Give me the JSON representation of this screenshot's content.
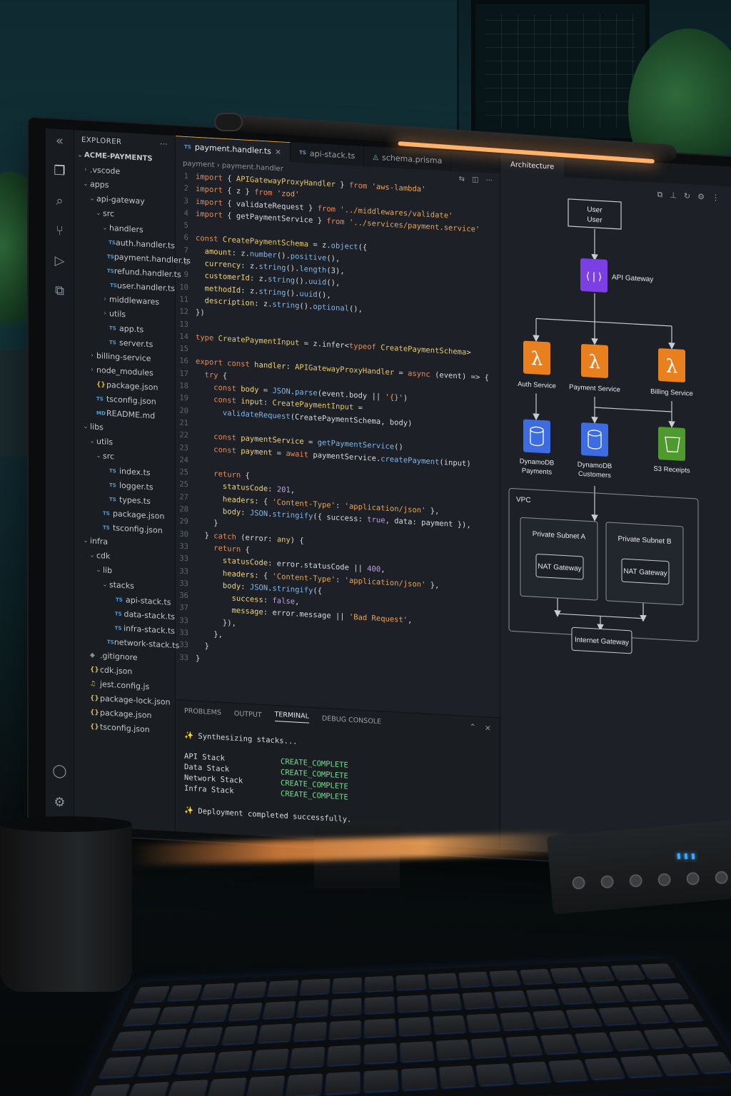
{
  "explorer": {
    "title": "EXPLORER",
    "more": "···",
    "root": "ACME-PAYMENTS",
    "tree": [
      {
        "depth": 0,
        "chev": "›",
        "icon": "",
        "label": ".vscode"
      },
      {
        "depth": 0,
        "chev": "⌄",
        "icon": "",
        "label": "apps"
      },
      {
        "depth": 1,
        "chev": "⌄",
        "icon": "",
        "label": "api-gateway"
      },
      {
        "depth": 2,
        "chev": "⌄",
        "icon": "",
        "label": "src"
      },
      {
        "depth": 3,
        "chev": "⌄",
        "icon": "",
        "label": "handlers"
      },
      {
        "depth": 4,
        "chev": "",
        "icon": "TS",
        "label": "auth.handler.ts"
      },
      {
        "depth": 4,
        "chev": "",
        "icon": "TS",
        "label": "payment.handler.ts"
      },
      {
        "depth": 4,
        "chev": "",
        "icon": "TS",
        "label": "refund.handler.ts"
      },
      {
        "depth": 4,
        "chev": "",
        "icon": "TS",
        "label": "user.handler.ts"
      },
      {
        "depth": 3,
        "chev": "›",
        "icon": "",
        "label": "middlewares"
      },
      {
        "depth": 3,
        "chev": "›",
        "icon": "",
        "label": "utils"
      },
      {
        "depth": 3,
        "chev": "",
        "icon": "TS",
        "label": "app.ts"
      },
      {
        "depth": 3,
        "chev": "",
        "icon": "TS",
        "label": "server.ts"
      },
      {
        "depth": 1,
        "chev": "›",
        "icon": "",
        "label": "billing-service"
      },
      {
        "depth": 1,
        "chev": "›",
        "icon": "",
        "label": "node_modules"
      },
      {
        "depth": 1,
        "chev": "",
        "icon": "{}",
        "label": "package.json"
      },
      {
        "depth": 1,
        "chev": "",
        "icon": "TS",
        "label": "tsconfig.json"
      },
      {
        "depth": 1,
        "chev": "",
        "icon": "MD",
        "label": "README.md"
      },
      {
        "depth": 0,
        "chev": "⌄",
        "icon": "",
        "label": "libs"
      },
      {
        "depth": 1,
        "chev": "⌄",
        "icon": "",
        "label": "utils"
      },
      {
        "depth": 2,
        "chev": "⌄",
        "icon": "",
        "label": "src"
      },
      {
        "depth": 3,
        "chev": "",
        "icon": "TS",
        "label": "index.ts"
      },
      {
        "depth": 3,
        "chev": "",
        "icon": "TS",
        "label": "logger.ts"
      },
      {
        "depth": 3,
        "chev": "",
        "icon": "TS",
        "label": "types.ts"
      },
      {
        "depth": 2,
        "chev": "",
        "icon": "TS",
        "label": "package.json"
      },
      {
        "depth": 2,
        "chev": "",
        "icon": "TS",
        "label": "tsconfig.json"
      },
      {
        "depth": 0,
        "chev": "⌄",
        "icon": "",
        "label": "infra"
      },
      {
        "depth": 1,
        "chev": "⌄",
        "icon": "",
        "label": "cdk"
      },
      {
        "depth": 2,
        "chev": "⌄",
        "icon": "",
        "label": "lib"
      },
      {
        "depth": 3,
        "chev": "⌄",
        "icon": "",
        "label": "stacks"
      },
      {
        "depth": 4,
        "chev": "",
        "icon": "TS",
        "label": "api-stack.ts"
      },
      {
        "depth": 4,
        "chev": "",
        "icon": "TS",
        "label": "data-stack.ts"
      },
      {
        "depth": 4,
        "chev": "",
        "icon": "TS",
        "label": "infra-stack.ts"
      },
      {
        "depth": 4,
        "chev": "",
        "icon": "TS",
        "label": "network-stack.ts"
      },
      {
        "depth": 0,
        "chev": "",
        "icon": "◆",
        "label": ".gitignore"
      },
      {
        "depth": 0,
        "chev": "",
        "icon": "{}",
        "label": "cdk.json"
      },
      {
        "depth": 0,
        "chev": "",
        "icon": "♫",
        "label": "jest.config.js"
      },
      {
        "depth": 0,
        "chev": "",
        "icon": "{}",
        "label": "package-lock.json"
      },
      {
        "depth": 0,
        "chev": "",
        "icon": "{}",
        "label": "package.json"
      },
      {
        "depth": 0,
        "chev": "",
        "icon": "{}",
        "label": "tsconfig.json"
      }
    ]
  },
  "tabs": [
    {
      "icon": "TS",
      "label": "payment.handler.ts",
      "active": true,
      "close": "×"
    },
    {
      "icon": "TS",
      "label": "api-stack.ts",
      "active": false,
      "close": ""
    },
    {
      "icon": "◬",
      "label": "schema.prisma",
      "active": false,
      "close": ""
    }
  ],
  "breadcrumb": "payment › payment.handler",
  "code": [
    {
      "n": "1",
      "parts": [
        [
          "k",
          "import"
        ],
        [
          "p",
          " { "
        ],
        [
          "t",
          "APIGatewayProxyHandler"
        ],
        [
          "p",
          " } "
        ],
        [
          "k",
          "from"
        ],
        [
          "s",
          " 'aws-lambda'"
        ]
      ]
    },
    {
      "n": "2",
      "parts": [
        [
          "k",
          "import"
        ],
        [
          "p",
          " { z } "
        ],
        [
          "k",
          "from"
        ],
        [
          "s",
          " 'zod'"
        ]
      ]
    },
    {
      "n": "3",
      "parts": [
        [
          "k",
          "import"
        ],
        [
          "p",
          " { validateRequest } "
        ],
        [
          "k",
          "from"
        ],
        [
          "s",
          " '../middlewares/validate'"
        ]
      ]
    },
    {
      "n": "4",
      "parts": [
        [
          "k",
          "import"
        ],
        [
          "p",
          " { getPaymentService } "
        ],
        [
          "k",
          "from"
        ],
        [
          "s",
          " '../services/payment.service'"
        ]
      ]
    },
    {
      "n": "5",
      "parts": []
    },
    {
      "n": "6",
      "parts": [
        [
          "k",
          "const"
        ],
        [
          "t",
          " CreatePaymentSchema"
        ],
        [
          "p",
          " = z."
        ],
        [
          "f",
          "object"
        ],
        [
          "p",
          "({"
        ]
      ]
    },
    {
      "n": "7",
      "parts": [
        [
          "v",
          "  amount"
        ],
        [
          "p",
          ": z."
        ],
        [
          "f",
          "number"
        ],
        [
          "p",
          "()."
        ],
        [
          "f",
          "positive"
        ],
        [
          "p",
          "(),"
        ]
      ]
    },
    {
      "n": "8",
      "parts": [
        [
          "v",
          "  currency"
        ],
        [
          "p",
          ": z."
        ],
        [
          "f",
          "string"
        ],
        [
          "p",
          "()."
        ],
        [
          "f",
          "length"
        ],
        [
          "p",
          "(3),"
        ]
      ]
    },
    {
      "n": "9",
      "parts": [
        [
          "v",
          "  customerId"
        ],
        [
          "p",
          ": z."
        ],
        [
          "f",
          "string"
        ],
        [
          "p",
          "()."
        ],
        [
          "f",
          "uuid"
        ],
        [
          "p",
          "(),"
        ]
      ]
    },
    {
      "n": "10",
      "parts": [
        [
          "v",
          "  methodId"
        ],
        [
          "p",
          ": z."
        ],
        [
          "f",
          "string"
        ],
        [
          "p",
          "()."
        ],
        [
          "f",
          "uuid"
        ],
        [
          "p",
          "(),"
        ]
      ]
    },
    {
      "n": "11",
      "parts": [
        [
          "v",
          "  description"
        ],
        [
          "p",
          ": z."
        ],
        [
          "f",
          "string"
        ],
        [
          "p",
          "()."
        ],
        [
          "f",
          "optional"
        ],
        [
          "p",
          "(),"
        ]
      ]
    },
    {
      "n": "12",
      "parts": [
        [
          "p",
          "})"
        ]
      ]
    },
    {
      "n": "13",
      "parts": []
    },
    {
      "n": "14",
      "parts": [
        [
          "k",
          "type"
        ],
        [
          "t",
          " CreatePaymentInput"
        ],
        [
          "p",
          " = z.infer<"
        ],
        [
          "k",
          "typeof"
        ],
        [
          "t",
          " CreatePaymentSchema"
        ],
        [
          "p",
          ">"
        ]
      ]
    },
    {
      "n": "15",
      "parts": []
    },
    {
      "n": "16",
      "parts": [
        [
          "k",
          "export const"
        ],
        [
          "v",
          " handler"
        ],
        [
          "p",
          ": "
        ],
        [
          "t",
          "APIGatewayProxyHandler"
        ],
        [
          "p",
          " = "
        ],
        [
          "k",
          "async"
        ],
        [
          "p",
          " (event) => {"
        ]
      ]
    },
    {
      "n": "17",
      "parts": [
        [
          "k",
          "  try"
        ],
        [
          "p",
          " {"
        ]
      ]
    },
    {
      "n": "18",
      "parts": [
        [
          "k",
          "    const"
        ],
        [
          "v",
          " body"
        ],
        [
          "p",
          " = "
        ],
        [
          "f",
          "JSON"
        ],
        [
          "p",
          "."
        ],
        [
          "f",
          "parse"
        ],
        [
          "p",
          "(event.body || "
        ],
        [
          "s",
          "'{}'"
        ],
        [
          "p",
          ")"
        ]
      ]
    },
    {
      "n": "19",
      "parts": [
        [
          "k",
          "    const"
        ],
        [
          "v",
          " input"
        ],
        [
          "p",
          ": "
        ],
        [
          "t",
          "CreatePaymentInput"
        ],
        [
          "p",
          " ="
        ]
      ]
    },
    {
      "n": "20",
      "parts": [
        [
          "f",
          "      validateRequest"
        ],
        [
          "p",
          "(CreatePaymentSchema, body)"
        ]
      ]
    },
    {
      "n": "21",
      "parts": []
    },
    {
      "n": "22",
      "parts": [
        [
          "k",
          "    const"
        ],
        [
          "v",
          " paymentService"
        ],
        [
          "p",
          " = "
        ],
        [
          "f",
          "getPaymentService"
        ],
        [
          "p",
          "()"
        ]
      ]
    },
    {
      "n": "23",
      "parts": [
        [
          "k",
          "    const"
        ],
        [
          "v",
          " payment"
        ],
        [
          "p",
          " = "
        ],
        [
          "k",
          "await"
        ],
        [
          "p",
          " paymentService."
        ],
        [
          "f",
          "createPayment"
        ],
        [
          "p",
          "(input)"
        ]
      ]
    },
    {
      "n": "24",
      "parts": []
    },
    {
      "n": "25",
      "parts": [
        [
          "k",
          "    return"
        ],
        [
          "p",
          " {"
        ]
      ]
    },
    {
      "n": "25",
      "parts": [
        [
          "v",
          "      statusCode"
        ],
        [
          "p",
          ": "
        ],
        [
          "n",
          "201"
        ],
        [
          "p",
          ","
        ]
      ]
    },
    {
      "n": "27",
      "parts": [
        [
          "v",
          "      headers"
        ],
        [
          "p",
          ": { "
        ],
        [
          "s",
          "'Content-Type'"
        ],
        [
          "p",
          ": "
        ],
        [
          "s",
          "'application/json'"
        ],
        [
          "p",
          " },"
        ]
      ]
    },
    {
      "n": "28",
      "parts": [
        [
          "v",
          "      body"
        ],
        [
          "p",
          ": "
        ],
        [
          "f",
          "JSON"
        ],
        [
          "p",
          "."
        ],
        [
          "f",
          "stringify"
        ],
        [
          "p",
          "({ success: "
        ],
        [
          "n",
          "true"
        ],
        [
          "p",
          ", data: payment }),"
        ]
      ]
    },
    {
      "n": "29",
      "parts": [
        [
          "p",
          "    }"
        ]
      ]
    },
    {
      "n": "30",
      "parts": [
        [
          "p",
          "  } "
        ],
        [
          "k",
          "catch"
        ],
        [
          "p",
          " (error: "
        ],
        [
          "t",
          "any"
        ],
        [
          "p",
          ") {"
        ]
      ]
    },
    {
      "n": "33",
      "parts": [
        [
          "k",
          "    return"
        ],
        [
          "p",
          " {"
        ]
      ]
    },
    {
      "n": "33",
      "parts": [
        [
          "v",
          "      statusCode"
        ],
        [
          "p",
          ": error.statusCode || "
        ],
        [
          "n",
          "400"
        ],
        [
          "p",
          ","
        ]
      ]
    },
    {
      "n": "33",
      "parts": [
        [
          "v",
          "      headers"
        ],
        [
          "p",
          ": { "
        ],
        [
          "s",
          "'Content-Type'"
        ],
        [
          "p",
          ": "
        ],
        [
          "s",
          "'application/json'"
        ],
        [
          "p",
          " },"
        ]
      ]
    },
    {
      "n": "33",
      "parts": [
        [
          "v",
          "      body"
        ],
        [
          "p",
          ": "
        ],
        [
          "f",
          "JSON"
        ],
        [
          "p",
          "."
        ],
        [
          "f",
          "stringify"
        ],
        [
          "p",
          "({"
        ]
      ]
    },
    {
      "n": "36",
      "parts": [
        [
          "v",
          "        success"
        ],
        [
          "p",
          ": "
        ],
        [
          "n",
          "false"
        ],
        [
          "p",
          ","
        ]
      ]
    },
    {
      "n": "37",
      "parts": [
        [
          "v",
          "        message"
        ],
        [
          "p",
          ": error.message || "
        ],
        [
          "s",
          "'Bad Request'"
        ],
        [
          "p",
          ","
        ]
      ]
    },
    {
      "n": "33",
      "parts": [
        [
          "p",
          "      }),"
        ]
      ]
    },
    {
      "n": "33",
      "parts": [
        [
          "p",
          "    },"
        ]
      ]
    },
    {
      "n": "33",
      "parts": [
        [
          "p",
          "  }"
        ]
      ]
    },
    {
      "n": "33",
      "parts": [
        [
          "p",
          "}"
        ]
      ]
    }
  ],
  "panel": {
    "tabs": [
      "PROBLEMS",
      "OUTPUT",
      "TERMINAL",
      "DEBUG CONSOLE"
    ],
    "active": "TERMINAL",
    "synth": "Synthesizing stacks...",
    "stacks": [
      {
        "name": "API Stack",
        "status": "CREATE_COMPLETE"
      },
      {
        "name": "Data Stack",
        "status": "CREATE_COMPLETE"
      },
      {
        "name": "Network Stack",
        "status": "CREATE_COMPLETE"
      },
      {
        "name": "Infra Stack",
        "status": "CREATE_COMPLETE"
      }
    ],
    "done": "Deployment completed successfully."
  },
  "architecture": {
    "tab": "Architecture",
    "user": [
      "User",
      "User"
    ],
    "api_gateway": "API Gateway",
    "services": [
      "Auth Service",
      "Payment Service",
      "Billing Service"
    ],
    "stores": [
      [
        "DynamoDB",
        "Payments"
      ],
      [
        "DynamoDB",
        "Customers"
      ],
      [
        "S3 Receipts"
      ]
    ],
    "vpc": "VPC",
    "subnets": [
      "Private Subnet A",
      "Private Subnet B"
    ],
    "nat": "NAT Gateway",
    "igw": "Internet Gateway",
    "colors": {
      "lambda": "#e8801f",
      "apigw": "#7b3fe4",
      "dynamo": "#3c6ce0",
      "s3": "#4f9a2e"
    }
  }
}
